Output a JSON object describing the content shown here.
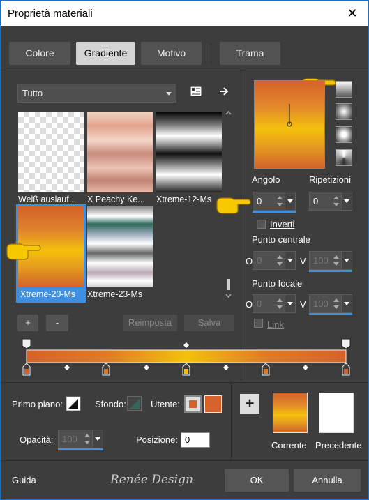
{
  "window": {
    "title": "Proprietà materiali",
    "close_glyph": "✕"
  },
  "tabs": [
    {
      "label": "Colore",
      "active": false
    },
    {
      "label": "Gradiente",
      "active": true
    },
    {
      "label": "Motivo",
      "active": false
    },
    {
      "label": "Trama",
      "active": false
    }
  ],
  "category_dropdown": {
    "value": "Tutto"
  },
  "gradients": [
    {
      "name": "Weiß auslauf...",
      "selected": false
    },
    {
      "name": "X Peachy Ke...",
      "selected": false
    },
    {
      "name": "Xtreme-12-Ms",
      "selected": false
    },
    {
      "name": "Xtreme-20-Ms",
      "selected": true
    },
    {
      "name": "Xtreme-23-Ms",
      "selected": false
    }
  ],
  "list_buttons": {
    "add": "+",
    "remove": "-",
    "reset": "Reimposta",
    "save": "Salva"
  },
  "style": {
    "angle_label": "Angolo",
    "angle_value": "0",
    "repeats_label": "Ripetizioni",
    "repeats_value": "0",
    "invert_label": "Inverti",
    "invert_checked": false,
    "center_label": "Punto centrale",
    "center_h_prefix": "O",
    "center_h": "0",
    "center_v_prefix": "V",
    "center_v": "100",
    "focal_label": "Punto focale",
    "focal_h_prefix": "O",
    "focal_h": "0",
    "focal_v_prefix": "V",
    "focal_v": "100",
    "link_label": "Link",
    "link_checked": false
  },
  "editor": {
    "primo_label": "Primo piano:",
    "sfondo_label": "Sfondo:",
    "utente_label": "Utente:",
    "add_glyph": "+",
    "opacity_label": "Opacità:",
    "opacity_value": "100",
    "position_label": "Posizione:",
    "position_value": "0",
    "current_label": "Corrente",
    "previous_label": "Precedente",
    "user_color": "#d4622a"
  },
  "footer": {
    "help": "Guida",
    "logo": "Renée Design",
    "ok": "OK",
    "cancel": "Annulla"
  },
  "colors": {
    "orange": "#d4622a",
    "yellow": "#f2c10c",
    "accent": "#3e8fdf",
    "panel": "#3d3d3d"
  }
}
